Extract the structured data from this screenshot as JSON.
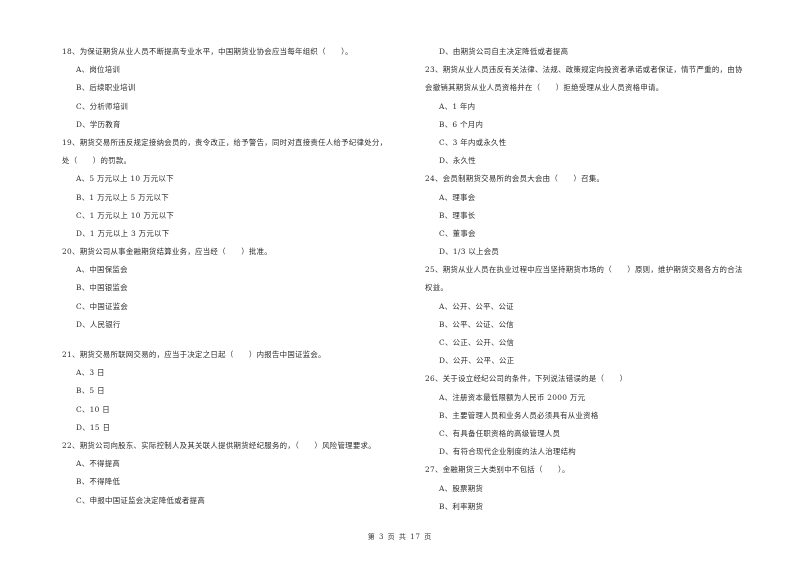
{
  "left_column": {
    "lines": [
      {
        "type": "q",
        "text": "18、为保证期货从业人员不断提高专业水平，中国期货业协会应当每年组织（　　）。"
      },
      {
        "type": "opt",
        "text": "A、岗位培训"
      },
      {
        "type": "opt",
        "text": "B、后续职业培训"
      },
      {
        "type": "opt",
        "text": "C、分析师培训"
      },
      {
        "type": "opt",
        "text": "D、学历教育"
      },
      {
        "type": "q",
        "text": "19、期货交易所违反规定接纳会员的，责令改正，给予警告，同时对直接责任人给予纪律处分，"
      },
      {
        "type": "cont",
        "text": "处（　　）的罚款。"
      },
      {
        "type": "opt",
        "text": "A、5 万元以上 10 万元以下"
      },
      {
        "type": "opt",
        "text": "B、1 万元以上 5 万元以下"
      },
      {
        "type": "opt",
        "text": "C、1 万元以上 10 万元以下"
      },
      {
        "type": "opt",
        "text": "D、1 万元以上 3 万元以下"
      },
      {
        "type": "q",
        "text": "20、期货公司从事金融期货结算业务，应当经（　　）批准。"
      },
      {
        "type": "opt",
        "text": "A、中国保监会"
      },
      {
        "type": "opt",
        "text": "B、中国银监会"
      },
      {
        "type": "opt",
        "text": "C、中国证监会"
      },
      {
        "type": "opt",
        "text": "D、人民银行"
      },
      {
        "type": "gap",
        "text": ""
      },
      {
        "type": "q",
        "text": "21、期货交易所联网交易的，应当于决定之日起（　　）内报告中国证监会。"
      },
      {
        "type": "opt",
        "text": "A、3 日"
      },
      {
        "type": "opt",
        "text": "B、5 日"
      },
      {
        "type": "opt",
        "text": "C、10 日"
      },
      {
        "type": "opt",
        "text": "D、15 日"
      },
      {
        "type": "q",
        "text": "22、期货公司向股东、实际控制人及其关联人提供期货经纪服务的，（　　）风险管理要求。"
      },
      {
        "type": "opt",
        "text": "A、不得提高"
      },
      {
        "type": "opt",
        "text": "B、不得降低"
      },
      {
        "type": "opt",
        "text": "C、申报中国证监会决定降低或者提高"
      }
    ]
  },
  "right_column": {
    "lines": [
      {
        "type": "opt",
        "text": "D、由期货公司自主决定降低或者提高"
      },
      {
        "type": "q",
        "text": "23、期货从业人员违反有关法律、法规、政策规定向投资者承诺或者保证，情节严重的，由协"
      },
      {
        "type": "cont",
        "text": "会撤销其期货从业人员资格并在（　　）拒绝受理从业人员资格申请。"
      },
      {
        "type": "opt",
        "text": "A、1 年内"
      },
      {
        "type": "opt",
        "text": "B、6 个月内"
      },
      {
        "type": "opt",
        "text": "C、3 年内或永久性"
      },
      {
        "type": "opt",
        "text": "D、永久性"
      },
      {
        "type": "q",
        "text": "24、会员制期货交易所的会员大会由（　　）召集。"
      },
      {
        "type": "opt",
        "text": "A、理事会"
      },
      {
        "type": "opt",
        "text": "B、理事长"
      },
      {
        "type": "opt",
        "text": "C、董事会"
      },
      {
        "type": "opt",
        "text": "D、1/3 以上会员"
      },
      {
        "type": "q",
        "text": "25、期货从业人员在执业过程中应当坚持期货市场的（　　）原则，维护期货交易各方的合法"
      },
      {
        "type": "cont",
        "text": "权益。"
      },
      {
        "type": "opt",
        "text": "A、公开、公平、公证"
      },
      {
        "type": "opt",
        "text": "B、公平、公证、公信"
      },
      {
        "type": "opt",
        "text": "C、公正、公开、公信"
      },
      {
        "type": "opt",
        "text": "D、公开、公平、公正"
      },
      {
        "type": "q",
        "text": "26、关于设立经纪公司的条件，下列说法错误的是（　　）"
      },
      {
        "type": "opt",
        "text": "A、注册资本最低限额为人民币 2000 万元"
      },
      {
        "type": "opt",
        "text": "B、主要管理人员和业务人员必须具有从业资格"
      },
      {
        "type": "opt",
        "text": "C、有具备任职资格的高级管理人员"
      },
      {
        "type": "opt",
        "text": "D、有符合现代企业制度的法人治理结构"
      },
      {
        "type": "q",
        "text": "27、金融期货三大类别中不包括（　　）。"
      },
      {
        "type": "opt",
        "text": "A、股票期货"
      },
      {
        "type": "opt",
        "text": "B、利率期货"
      }
    ]
  },
  "footer": {
    "page_label": "第 3 页 共 17 页"
  }
}
